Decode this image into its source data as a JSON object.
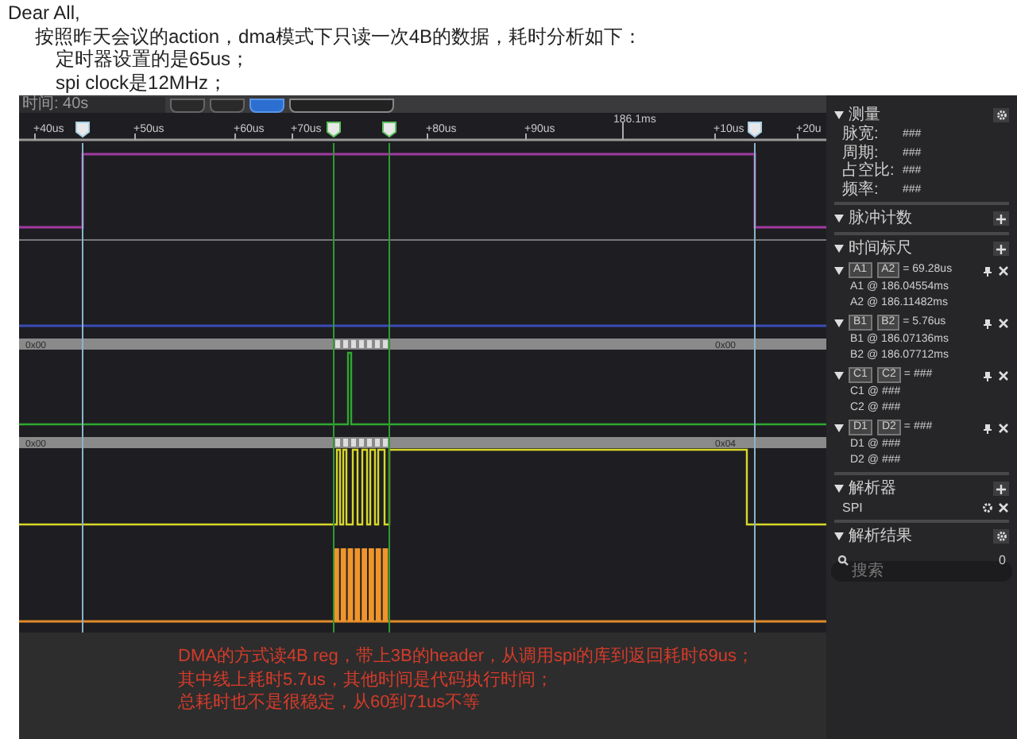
{
  "message": {
    "greeting": "Dear All,",
    "intro": "按照昨天会议的action，dma模式下只读一次4B的数据，耗时分析如下：",
    "details": [
      "定时器设置的是65us；",
      "spi clock是12MHz；"
    ]
  },
  "analyzer": {
    "toolbar": {
      "time_label": "时间: 40s"
    },
    "ruler": {
      "ticks": [
        "+40us",
        "+50us",
        "+60us",
        "+70us",
        "+80us",
        "+90us",
        "+10us",
        "+20u"
      ],
      "major_label": "186.1ms"
    },
    "buses": [
      {
        "labels": [
          "0x00",
          "0x00"
        ]
      },
      {
        "labels": [
          "0x00",
          "0x04"
        ]
      }
    ],
    "note": [
      "DMA的方式读4B reg，带上3B的header，从调用spi的库到返回耗时69us；",
      "其中线上耗时5.7us，其他时间是代码执行时间；",
      "总耗时也不是很稳定，从60到71us不等"
    ]
  },
  "panel": {
    "sections": [
      {
        "kind": "measure",
        "title": "测量",
        "expanded": true,
        "rows": [
          {
            "label": "脉宽:",
            "value": "###"
          },
          {
            "label": "周期:",
            "value": "###"
          },
          {
            "label": "占空比:",
            "value": "###"
          },
          {
            "label": "频率:",
            "value": "###"
          }
        ]
      },
      {
        "kind": "plain",
        "title": "脉冲计数",
        "expanded": true
      },
      {
        "kind": "rulers",
        "title": "时间标尺",
        "expanded": true,
        "pairs": [
          {
            "left": "A1",
            "right": "A2",
            "delta": "= 69.28us",
            "expanded": true,
            "items": [
              "A1 @ 186.04554ms",
              "A2 @ 186.11482ms"
            ]
          },
          {
            "left": "B1",
            "right": "B2",
            "delta": "= 5.76us",
            "expanded": true,
            "items": [
              "B1 @ 186.07136ms",
              "B2 @ 186.07712ms"
            ]
          },
          {
            "left": "C1",
            "right": "C2",
            "delta": "= ###",
            "expanded": true,
            "items": [
              "C1 @ ###",
              "C2 @ ###"
            ]
          },
          {
            "left": "D1",
            "right": "D2",
            "delta": "= ###",
            "expanded": true,
            "items": [
              "D1 @ ###",
              "D2 @ ###"
            ]
          }
        ]
      },
      {
        "kind": "decoders",
        "title": "解析器",
        "expanded": true,
        "items": [
          "SPI"
        ]
      },
      {
        "kind": "results",
        "title": "解析结果",
        "expanded": true,
        "search_placeholder": "搜索",
        "count": "0"
      }
    ]
  }
}
